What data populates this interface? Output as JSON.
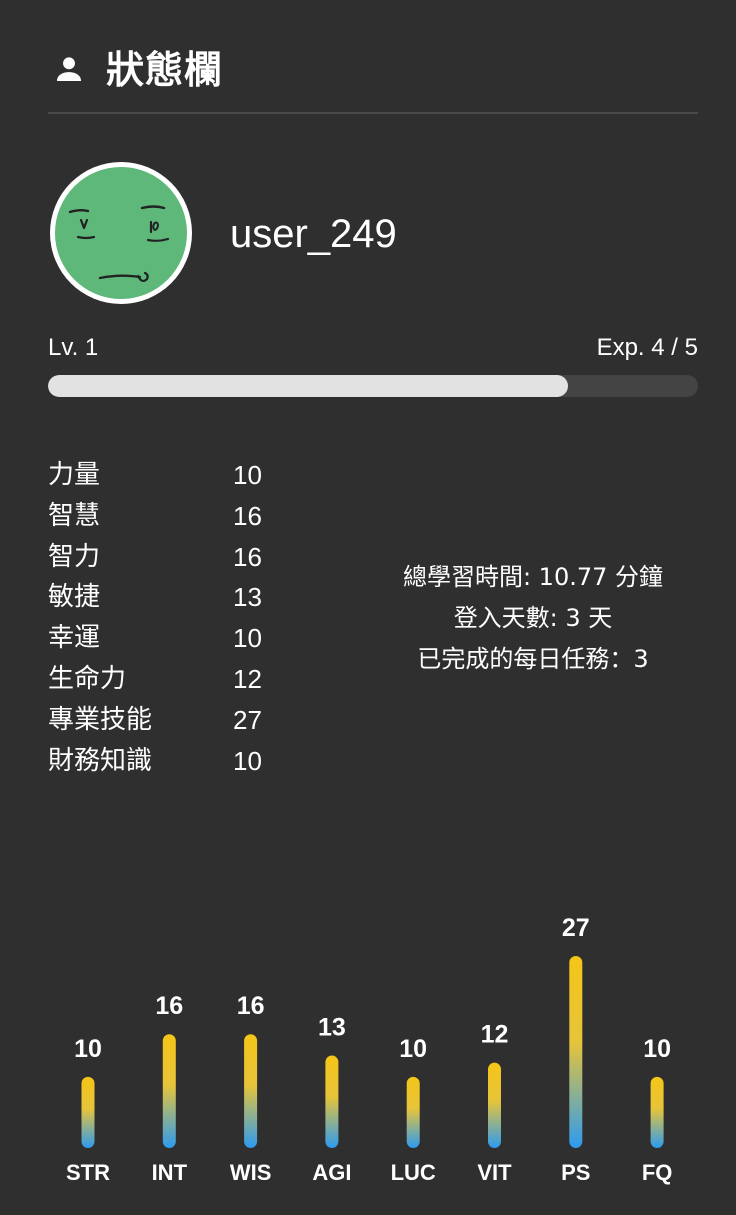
{
  "header": {
    "title": "狀態欄",
    "icon": "user-icon"
  },
  "profile": {
    "username": "user_249",
    "avatar": "face-avatar",
    "level_label": "Lv. 1",
    "exp_label": "Exp.",
    "exp_current": "4",
    "exp_separator": " / ",
    "exp_max": "5",
    "exp_fraction": 0.8
  },
  "stats": [
    {
      "name": "力量",
      "value": "10"
    },
    {
      "name": "智慧",
      "value": "16"
    },
    {
      "name": "智力",
      "value": "16"
    },
    {
      "name": "敏捷",
      "value": "13"
    },
    {
      "name": "幸運",
      "value": "10"
    },
    {
      "name": "生命力",
      "value": "12"
    },
    {
      "name": "專業技能",
      "value": "27"
    },
    {
      "name": "財務知識",
      "value": "10"
    }
  ],
  "summary": {
    "study_time": "總學習時間: 10.77 分鐘",
    "login_days": "登入天數: 3 天",
    "daily_tasks": "已完成的每日任務：3"
  },
  "colors": {
    "background": "#2f2f2f",
    "avatar_fill": "#5db87a",
    "bar_top": "#f5c518",
    "bar_bottom": "#2d9bf0",
    "progress_fill": "#e2e2e2",
    "progress_track": "#444444"
  },
  "chart_data": {
    "type": "bar",
    "categories": [
      "STR",
      "INT",
      "WIS",
      "AGI",
      "LUC",
      "VIT",
      "PS",
      "FQ"
    ],
    "values": [
      10,
      16,
      16,
      13,
      10,
      12,
      27,
      10
    ],
    "ylim": [
      0,
      27
    ],
    "grid": false
  }
}
